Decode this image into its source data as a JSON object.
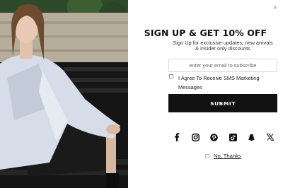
{
  "popup": {
    "close_symbol": "×",
    "title": "SIGN UP & GET 10% OFF",
    "subtitle_line1": "Sign Up for exclusive updates, new arrivals",
    "subtitle_line2": "& insider only discounts",
    "email_placeholder": "enter your email to subscribe",
    "consent_label_line1": "I Agree To Receive SMS Marketing",
    "consent_label_line2": "Messages",
    "submit_label": "SUBMIT",
    "decline_label": "No, Thanks",
    "social_icons": [
      "facebook-icon",
      "instagram-icon",
      "pinterest-icon",
      "tiktok-icon",
      "snapchat-icon",
      "x-icon"
    ]
  },
  "colors": {
    "button_bg": "#111111",
    "button_text": "#ffffff",
    "icon_color": "#111111"
  }
}
